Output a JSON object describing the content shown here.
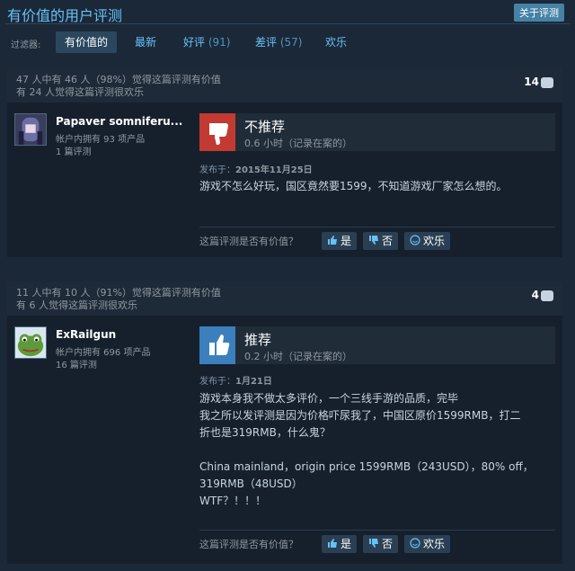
{
  "header": {
    "title": "有价值的用户评测",
    "about_button": "关于评测"
  },
  "filters": {
    "label": "过滤器:",
    "tabs": [
      {
        "label": "有价值的",
        "count": ""
      },
      {
        "label": "最新",
        "count": ""
      },
      {
        "label": "好评",
        "count": "(91)"
      },
      {
        "label": "差评",
        "count": "(57)"
      },
      {
        "label": "欢乐",
        "count": ""
      }
    ]
  },
  "reviews": [
    {
      "helpful_line1": "47 人中有 46 人（98%）觉得这篇评测有价值",
      "helpful_line2": "有 24 人觉得这篇评测很欢乐",
      "comment_count": "14",
      "username": "Papaver somniferu...",
      "products": "帐户内拥有 93 项产品",
      "reviews_count": "1 篇评测",
      "verdict": "不推荐",
      "hours": "0.6 小时（记录在案的）",
      "posted_label": "发布于：",
      "posted_date": "2015年11月25日",
      "text": [
        "游戏不怎么好玩，国区竟然要1599，不知道游戏厂家怎么想的。"
      ],
      "vote_question": "这篇评测是否有价值？",
      "yes": "是",
      "no": "否",
      "funny": "欢乐"
    },
    {
      "helpful_line1": "11 人中有 10 人（91%）觉得这篇评测有价值",
      "helpful_line2": "有 6 人觉得这篇评测很欢乐",
      "comment_count": "4",
      "username": "ExRailgun",
      "products": "帐户内拥有 696 项产品",
      "reviews_count": "16 篇评测",
      "verdict": "推荐",
      "hours": "0.2 小时（记录在案的）",
      "posted_label": "发布于：",
      "posted_date": "1月21日",
      "text": [
        "游戏本身我不做太多评价，一个三线手游的品质，完毕",
        "我之所以发评测是因为价格吓尿我了，中国区原价1599RMB，打二",
        "折也是319RMB，什么鬼？",
        "",
        "China mainland，origin price 1599RMB（243USD），80% off，",
        "319RMB（48USD）",
        "WTF？！！！"
      ],
      "vote_question": "这篇评测是否有价值？",
      "yes": "是",
      "no": "否",
      "funny": "欢乐"
    }
  ],
  "colors": {
    "thumb_down": "#c23a32",
    "thumb_up": "#3c7fbd",
    "accent": "#67c1f5"
  }
}
